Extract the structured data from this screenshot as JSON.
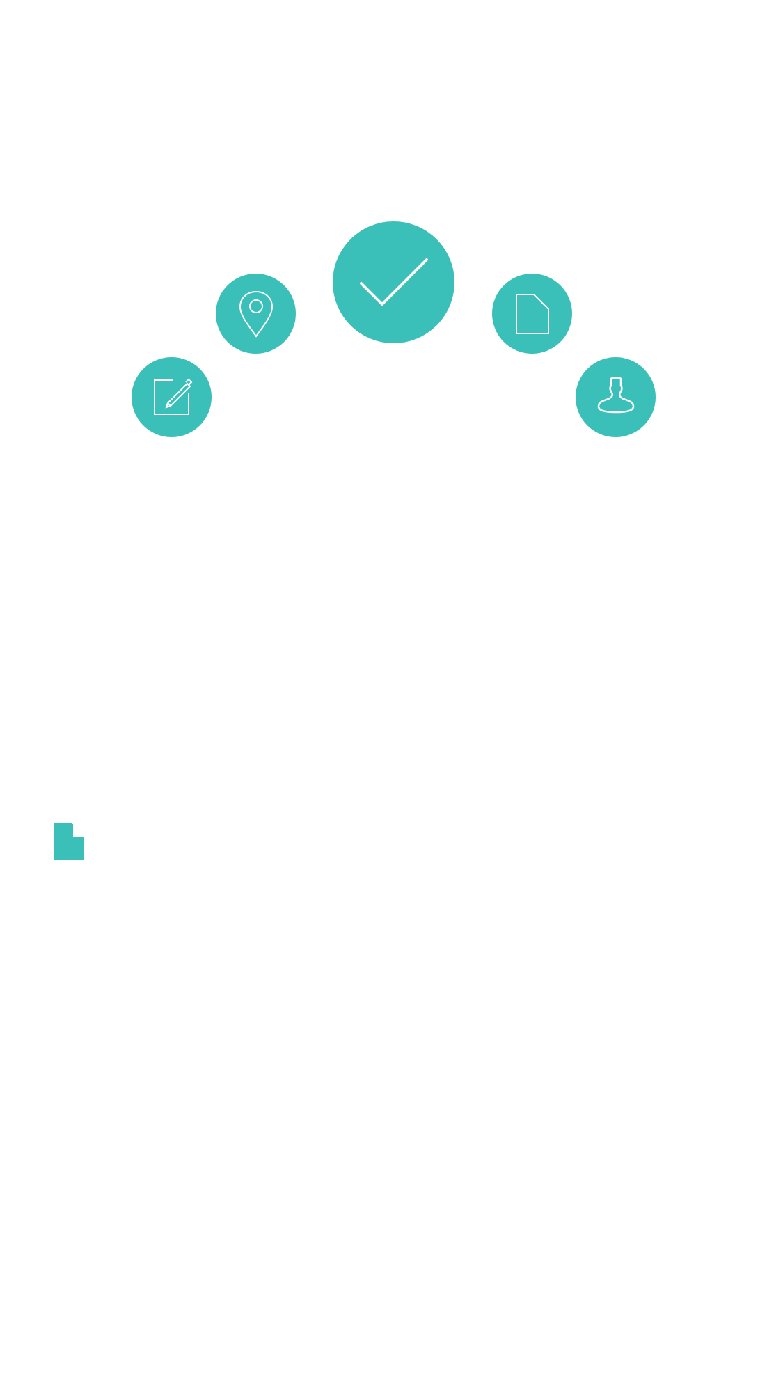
{
  "colors": {
    "background": "#ffffff",
    "accent": "#3bbfb9",
    "icon_stroke": "#ffffff"
  },
  "radial_menu": {
    "items": [
      {
        "id": "edit",
        "icon": "edit-icon"
      },
      {
        "id": "location",
        "icon": "location-pin-icon"
      },
      {
        "id": "confirm",
        "icon": "checkmark-icon",
        "primary": true
      },
      {
        "id": "document",
        "icon": "document-icon"
      },
      {
        "id": "profile",
        "icon": "user-icon"
      }
    ]
  },
  "floating_element": {
    "icon": "document-fold-icon"
  }
}
